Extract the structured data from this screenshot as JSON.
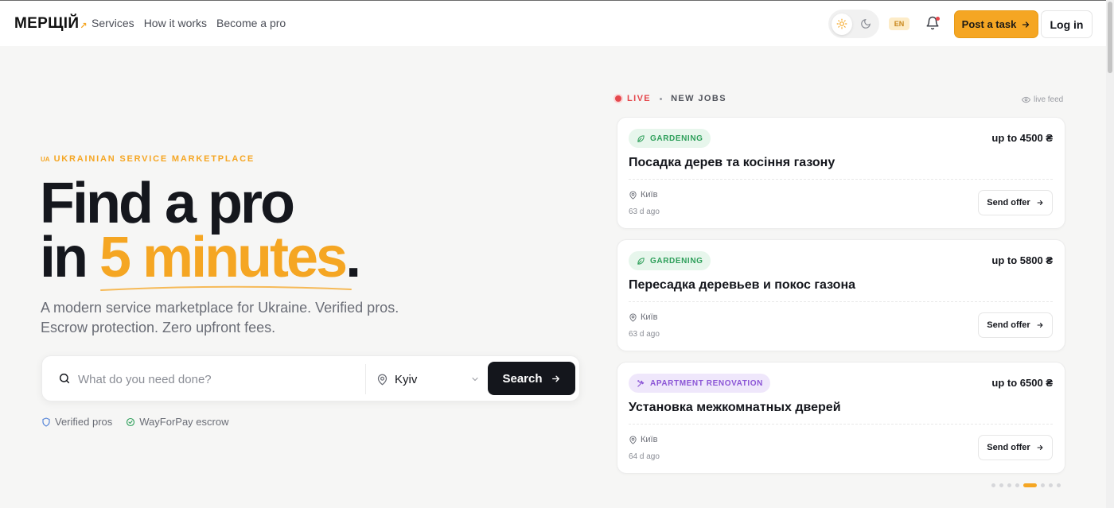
{
  "header": {
    "logo": "МЕРЩІЙ",
    "logo_mark": "↗",
    "nav": [
      "Services",
      "How it works",
      "Become a pro"
    ],
    "lang": "EN",
    "post_task": "Post a task",
    "login": "Log in"
  },
  "hero": {
    "eyebrow_flag": "UA",
    "eyebrow": "UKRAINIAN SERVICE MARKETPLACE",
    "headline_line1": "Find a pro",
    "headline_in": "in ",
    "headline_accent": "5 minutes",
    "headline_period": ".",
    "sub_line1": "A modern service marketplace for Ukraine. Verified pros.",
    "sub_line2": "Escrow protection. Zero upfront fees.",
    "search_placeholder": "What do you need done?",
    "city": "Kyiv",
    "search_button": "Search",
    "trust": [
      "Verified pros",
      "WayForPay escrow"
    ]
  },
  "feed": {
    "live": "LIVE",
    "new_jobs": "NEW JOBS",
    "live_feed": "live feed",
    "jobs": [
      {
        "category": "GARDENING",
        "price": "up to 4500 ₴",
        "title": "Посадка дерев та косіння газону",
        "city": "Київ",
        "ago": "63 d ago",
        "offer": "Send offer"
      },
      {
        "category": "GARDENING",
        "price": "up to 5800 ₴",
        "title": "Пересадка деревьев и покос газона",
        "city": "Київ",
        "ago": "63 d ago",
        "offer": "Send offer"
      },
      {
        "category": "APARTMENT RENOVATION",
        "price": "up to 6500 ₴",
        "title": "Установка межкомнатных дверей",
        "city": "Київ",
        "ago": "64 d ago",
        "offer": "Send offer"
      }
    ],
    "pager_count": 8,
    "pager_active": 4
  },
  "colors": {
    "accent": "#f5a623",
    "dark": "#14161c",
    "live": "#e5484d",
    "green": "#2e9f5a",
    "purple": "#8b55d6"
  },
  "icons": [
    "sun-icon",
    "moon-icon",
    "bell-icon",
    "arrow-right-icon",
    "search-icon",
    "map-pin-icon",
    "chevron-down-icon",
    "shield-icon",
    "check-circle-icon",
    "eye-icon",
    "leaf-icon",
    "tools-icon"
  ]
}
